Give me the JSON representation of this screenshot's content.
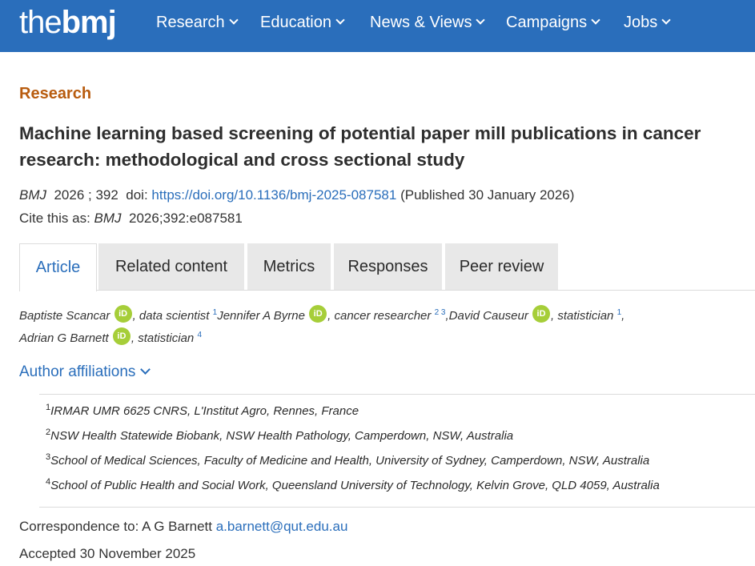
{
  "brand": {
    "logo_the": "the",
    "logo_bmj": "bmj",
    "bar_color": "#2a6ebb"
  },
  "nav": [
    {
      "label": "Research"
    },
    {
      "label": "Education"
    },
    {
      "label": "News & Views"
    },
    {
      "label": "Campaigns"
    },
    {
      "label": "Jobs"
    }
  ],
  "article": {
    "section": "Research",
    "title": "Machine learning based screening of potential paper mill publications in cancer research: methodological and cross sectional study",
    "journal": "BMJ",
    "year_vol": "2026 ; 392",
    "doi_label": "doi:",
    "doi_link": "https://doi.org/10.1136/bmj-2025-087581",
    "published": "(Published 30 January 2026)",
    "cite_label": "Cite this as:",
    "cite_journal": "BMJ",
    "cite_ref": "2026;392:e087581"
  },
  "tabs": [
    {
      "label": "Article",
      "active": true
    },
    {
      "label": "Related content"
    },
    {
      "label": "Metrics"
    },
    {
      "label": "Responses"
    },
    {
      "label": "Peer review"
    }
  ],
  "authors": [
    {
      "name": "Baptiste Scancar",
      "role": ", data scientist",
      "refs": "1"
    },
    {
      "name": "Jennifer A Byrne",
      "role": ", cancer researcher",
      "refs": "2 3"
    },
    {
      "name": "David Causeur",
      "role": ", statistician",
      "refs": "1"
    },
    {
      "name": "Adrian G Barnett",
      "role": ", statistician",
      "refs": "4"
    }
  ],
  "orcid_label": "iD",
  "affiliations_toggle": "Author affiliations",
  "affiliations": [
    {
      "num": "1",
      "text": "IRMAR UMR 6625 CNRS, L'Institut Agro, Rennes, France"
    },
    {
      "num": "2",
      "text": "NSW Health Statewide Biobank, NSW Health Pathology, Camperdown, NSW, Australia"
    },
    {
      "num": "3",
      "text": "School of Medical Sciences, Faculty of Medicine and Health, University of Sydney, Camperdown, NSW, Australia"
    },
    {
      "num": "4",
      "text": "School of Public Health and Social Work, Queensland University of Technology, Kelvin Grove, QLD 4059, Australia"
    }
  ],
  "correspondence": {
    "label": "Correspondence to: A G Barnett",
    "email": "a.barnett@qut.edu.au"
  },
  "accepted": "Accepted 30 November 2025",
  "colors": {
    "accent": "#2a6ebb",
    "section": "#b85c0f",
    "orcid": "#a6ce39"
  }
}
